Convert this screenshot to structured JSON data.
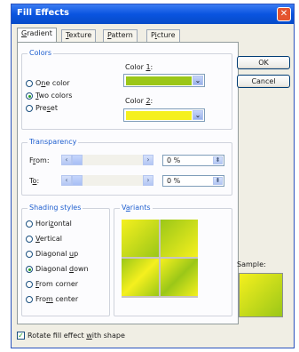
{
  "window": {
    "title": "Fill Effects",
    "close_symbol": "✕"
  },
  "tabs": [
    {
      "label_pre": "",
      "label_u": "G",
      "label_post": "radient",
      "active": true
    },
    {
      "label_pre": "",
      "label_u": "T",
      "label_post": "exture",
      "active": false
    },
    {
      "label_pre": "",
      "label_u": "P",
      "label_post": "attern",
      "active": false
    },
    {
      "label_pre": "P",
      "label_u": "i",
      "label_post": "cture",
      "active": false
    }
  ],
  "colors_group": {
    "title": "Colors",
    "options": [
      {
        "pre": "O",
        "u": "n",
        "post": "e color",
        "checked": false
      },
      {
        "pre": "",
        "u": "T",
        "post": "wo colors",
        "checked": true
      },
      {
        "pre": "Pre",
        "u": "s",
        "post": "et",
        "checked": false
      }
    ],
    "color1_label_pre": "Color ",
    "color1_label_u": "1",
    "color1_label_post": ":",
    "color1_value": "#9bc718",
    "color2_label_pre": "Color ",
    "color2_label_u": "2",
    "color2_label_post": ":",
    "color2_value": "#f5f01e"
  },
  "transparency_group": {
    "title": "Transparency",
    "from_label_pre": "F",
    "from_label_u": "r",
    "from_label_post": "om:",
    "from_value": "0 %",
    "to_label_pre": "T",
    "to_label_u": "o",
    "to_label_post": ":",
    "to_value": "0 %"
  },
  "shading_group": {
    "title": "Shading styles",
    "options": [
      {
        "pre": "Hori",
        "u": "z",
        "post": "ontal",
        "checked": false
      },
      {
        "pre": "",
        "u": "V",
        "post": "ertical",
        "checked": false
      },
      {
        "pre": "Diagonal ",
        "u": "u",
        "post": "p",
        "checked": false
      },
      {
        "pre": "Diagonal ",
        "u": "d",
        "post": "own",
        "checked": true
      },
      {
        "pre": "",
        "u": "F",
        "post": "rom corner",
        "checked": false
      },
      {
        "pre": "Fro",
        "u": "m",
        "post": " center",
        "checked": false
      }
    ]
  },
  "variants_group": {
    "title_pre": "V",
    "title_u": "a",
    "title_post": "riants"
  },
  "gradient": {
    "color_a": "#9bc718",
    "color_b": "#f5f01e"
  },
  "buttons": {
    "ok": "OK",
    "cancel": "Cancel"
  },
  "sample": {
    "label": "Sample:"
  },
  "rotate_checkbox": {
    "pre": "Rotate fill effect ",
    "u": "w",
    "post": "ith shape",
    "checked": true,
    "check_mark": "✓"
  },
  "icons": {
    "dropdown_arrow": "⌄",
    "left_arrow": "‹",
    "right_arrow": "›",
    "spin_arrows": "⬍"
  }
}
